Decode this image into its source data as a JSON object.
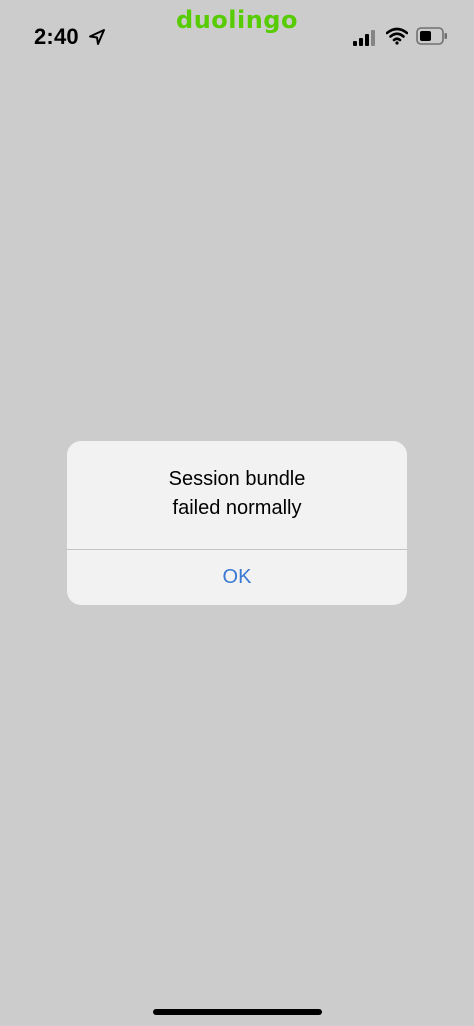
{
  "status_bar": {
    "time": "2:40",
    "app_brand": "duolingo",
    "icons": [
      "location-arrow-icon",
      "cellular-signal-icon",
      "wifi-icon",
      "battery-icon"
    ]
  },
  "alert": {
    "line1": "Session bundle",
    "line2": "failed normally",
    "ok_label": "OK"
  },
  "colors": {
    "background": "#cccccc",
    "alert_background": "#f2f2f2",
    "button_text": "#3a78d4",
    "brand": "#58cc02"
  }
}
